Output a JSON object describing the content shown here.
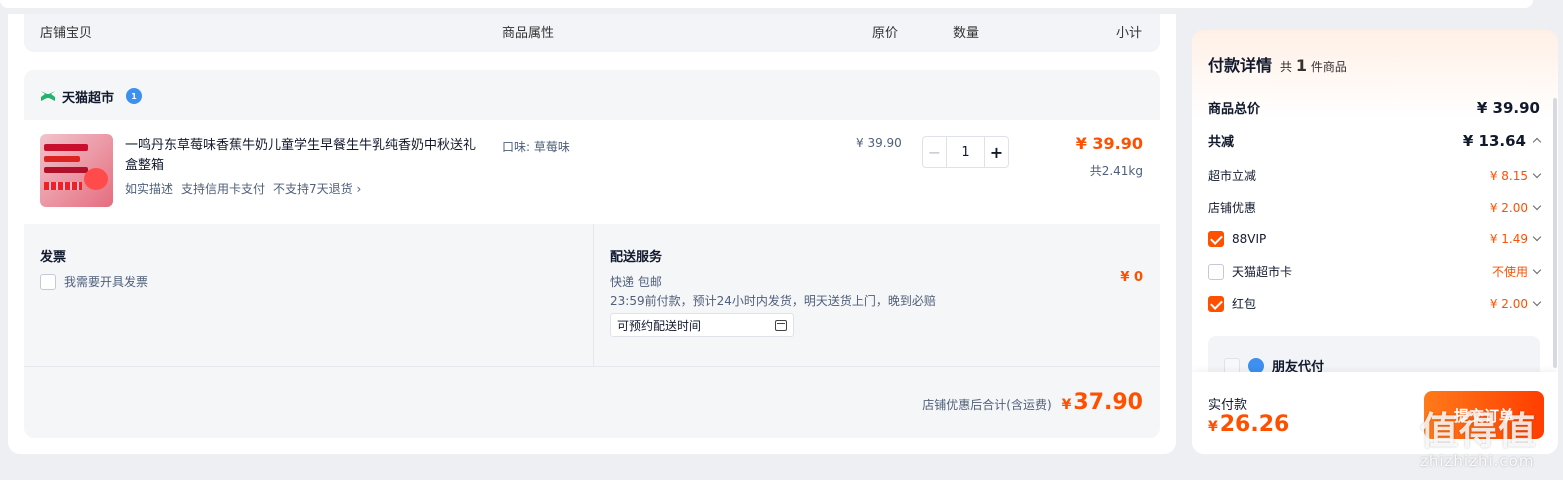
{
  "table_header": {
    "shop_item": "店铺宝贝",
    "attributes": "商品属性",
    "original_price": "原价",
    "quantity": "数量",
    "subtotal": "小计"
  },
  "shop": {
    "name": "天猫超市",
    "badge": "1",
    "item": {
      "name": "一鸣丹东草莓味香蕉牛奶儿童学生早餐生牛乳纯香奶中秋送礼盒整箱",
      "tags": [
        "如实描述",
        "支持信用卡支付",
        "不支持7天退货 ›"
      ],
      "attribute": "口味: 草莓味",
      "price": "¥ 39.90",
      "quantity": "1",
      "subtotal": "¥ 39.90",
      "weight": "共2.41kg"
    },
    "invoice": {
      "title": "发票",
      "option": "我需要开具发票"
    },
    "delivery": {
      "title": "配送服务",
      "line1": "快递 包邮",
      "line2": "23:59前付款，预计24小时内发货，明天送货上门，晚到必赔",
      "fee": "¥ 0",
      "date_placeholder": "可预约配送时间"
    },
    "total_label": "店铺优惠后合计(含运费)",
    "total_currency": "¥",
    "total_value": "37.90"
  },
  "payment": {
    "title": "付款详情",
    "count_prefix": "共",
    "count": "1",
    "count_suffix": "件商品",
    "goods_total_label": "商品总价",
    "goods_total": "¥ 39.90",
    "discount_label": "共减",
    "discount_total": "¥ 13.64",
    "discounts": [
      {
        "label": "超市立减",
        "value": "¥ 8.15",
        "checkbox": "none"
      },
      {
        "label": "店铺优惠",
        "value": "¥ 2.00",
        "checkbox": "none"
      },
      {
        "label": "88VIP",
        "value": "¥ 1.49",
        "checkbox": "checked"
      },
      {
        "label": "天猫超市卡",
        "value": "不使用",
        "checkbox": "unchecked"
      },
      {
        "label": "红包",
        "value": "¥ 2.00",
        "checkbox": "checked"
      }
    ],
    "friend_pay": "朋友代付",
    "actual_label": "实付款",
    "actual_currency": "¥",
    "actual_value": "26.26",
    "submit_label": "提交订单"
  },
  "watermark": {
    "main": "值得值",
    "sub": "zhizhizhi.com"
  },
  "colors": {
    "accent": "#ff5000",
    "page_bg": "#eeeff2",
    "card_bg": "#f5f6f8"
  }
}
